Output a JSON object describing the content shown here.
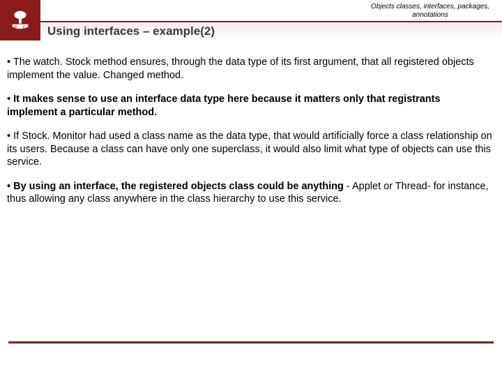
{
  "header": {
    "topic_line1": "Objects classes, interfaces, packages,",
    "topic_line2": "annotations",
    "title": "Using interfaces – example(2)",
    "logo_letters_left": "P",
    "logo_letters_right": "Ł"
  },
  "bullets": [
    {
      "marker": "• ",
      "pre": "The watch",
      "post": ". "
    },
    {
      "marker": "• ",
      "bold": "It makes sense to use an interface data type here because it matters only that registrants implement a particular method."
    },
    {
      "marker": "• ",
      "plain": "If Stock. Monitor had used a class name as the data type, that would artificially force a class relationship on its users. Because a class can have only one superclass, it would also limit what type of objects can use this service."
    },
    {
      "marker": "• ",
      "bold": "By using an interface, the registered objects class could be anything",
      "tail": " - Applet or Thread- for instance, thus allowing any class anywhere in the class hierarchy to use this service."
    }
  ],
  "bullet0_detail": {
    "seg1": "Stock method ensures, through the data type of its first argument, that all registered objects implement the value",
    "seg2": "Changed method"
  },
  "colors": {
    "brand": "#8b1a1a"
  }
}
